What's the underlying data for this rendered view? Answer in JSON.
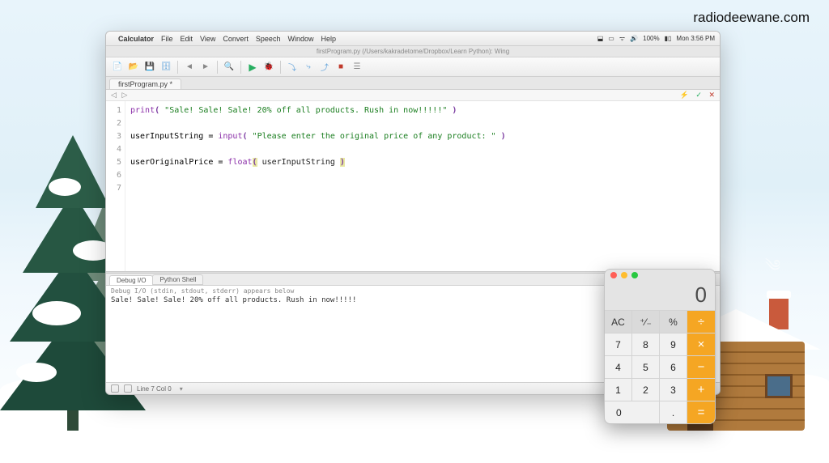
{
  "watermark": "radiodeewane.com",
  "menubar": {
    "app": "Calculator",
    "items": [
      "File",
      "Edit",
      "View",
      "Convert",
      "Speech",
      "Window",
      "Help"
    ],
    "battery": "100%",
    "clock": "Mon 3:56 PM"
  },
  "window": {
    "title": "firstProgram.py (/Users/kakradetome/Dropbox/Learn Python): Wing"
  },
  "file_tab": "firstProgram.py",
  "editor_icons": {
    "bolt": "⚡",
    "check": "✓",
    "close": "✕"
  },
  "code": {
    "lines": [
      "1",
      "2",
      "3",
      "4",
      "5",
      "6",
      "7"
    ],
    "l1_fn": "print",
    "l1_str": "\"Sale! Sale! Sale! 20% off all products. Rush in now!!!!!\"",
    "l3_var": "userInputString",
    "l3_eq": " = ",
    "l3_fn": "input",
    "l3_str": "\"Please enter the original price of any product: \"",
    "l5_var": "userOriginalPrice",
    "l5_eq": " = ",
    "l5_fn": "float",
    "l5_arg": " userInputString "
  },
  "panel": {
    "tabs": [
      "Debug I/O",
      "Python Shell"
    ],
    "meta": "Debug I/O (stdin, stdout, stderr) appears below",
    "output": "Sale! Sale! Sale! 20% off all products. Rush in now!!!!!"
  },
  "statusbar": {
    "pos": "Line 7 Col 0"
  },
  "calc": {
    "display": "0",
    "keys": {
      "ac": "AC",
      "sign": "⁺⁄₋",
      "pct": "%",
      "div": "÷",
      "k7": "7",
      "k8": "8",
      "k9": "9",
      "mul": "×",
      "k4": "4",
      "k5": "5",
      "k6": "6",
      "sub": "−",
      "k1": "1",
      "k2": "2",
      "k3": "3",
      "add": "+",
      "k0": "0",
      "dot": ".",
      "eq": "="
    }
  }
}
